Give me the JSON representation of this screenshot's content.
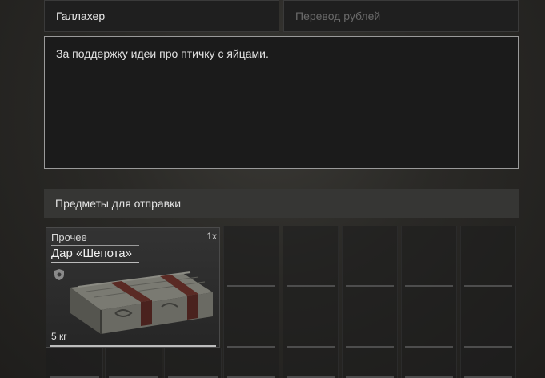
{
  "form": {
    "recipient": "Галлахер",
    "amount_placeholder": "Перевод рублей",
    "message": "За поддержку идеи про птичку с яйцами."
  },
  "items_section": {
    "title": "Предметы для отправки"
  },
  "item": {
    "category": "Прочее",
    "name": "Дар «Шепота»",
    "quantity": "1x",
    "weight": "5 кг",
    "badge_icon": "shield-icon",
    "image_icon": "crate-icon"
  },
  "colors": {
    "accent_border": "#9a9a9a",
    "background": "#2a2926"
  }
}
